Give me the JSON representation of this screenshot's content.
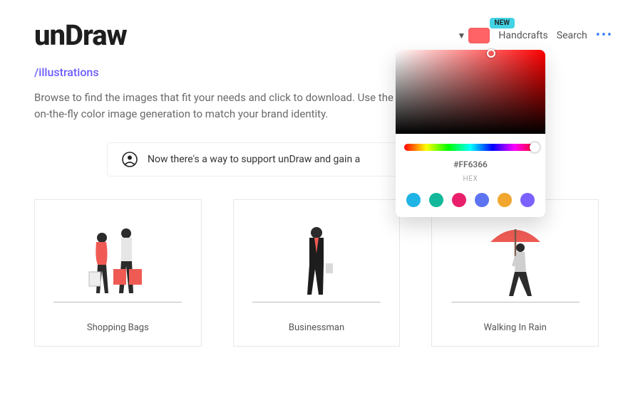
{
  "header": {
    "logo": "unDraw",
    "new_badge": "NEW",
    "handcrafts": "Handcrafts",
    "search": "Search"
  },
  "subtitle": "/illustrations",
  "description": "Browse to find the images that fit your needs and click to download. Use the on-the-fly color image generation to match your brand identity.",
  "banner": {
    "text": "Now there's a way to support unDraw and gain a"
  },
  "color_picker": {
    "hex_value": "#FF6366",
    "hex_label": "HEX",
    "swatch_color": "#FF6366",
    "presets": [
      "#1fb3e6",
      "#13b89a",
      "#ea1f6c",
      "#5c73f2",
      "#f0a62f",
      "#7b61ff"
    ]
  },
  "cards": [
    {
      "title": "Shopping Bags"
    },
    {
      "title": "Businessman"
    },
    {
      "title": "Walking In Rain"
    }
  ],
  "accent": "#FF6366"
}
